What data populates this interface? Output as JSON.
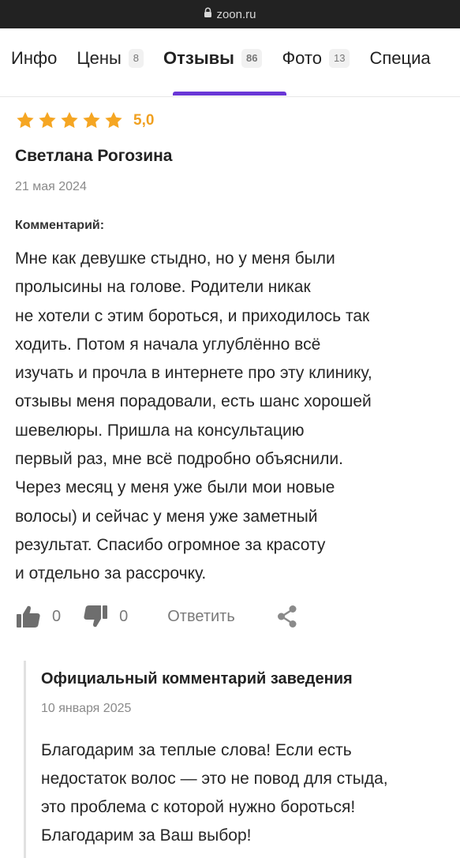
{
  "browser": {
    "url": "zoon.ru"
  },
  "tabs": [
    {
      "label": "Инфо",
      "count": ""
    },
    {
      "label": "Цены",
      "count": "8"
    },
    {
      "label": "Отзывы",
      "count": "86"
    },
    {
      "label": "Фото",
      "count": "13"
    },
    {
      "label": "Специа",
      "count": ""
    }
  ],
  "review": {
    "rating": "5,0",
    "stars": 5,
    "author": "Светлана Рогозина",
    "date": "21 мая 2024",
    "comment_label": "Комментарий:",
    "text_lines": [
      "Мне как девушке стыдно, но у меня были",
      "пролысины на голове. Родители никак",
      "не хотели с этим бороться, и приходилось так",
      "ходить. Потом я начала углублённо всё",
      "изучать и прочла в интернете про эту клинику,",
      "отзывы меня порадовали, есть шанс хорошей",
      "шевелюры. Пришла на консультацию",
      "первый раз, мне всё подробно объяснили.",
      "Через месяц у меня уже были мои новые",
      "волосы) и сейчас у меня уже заметный",
      "результат. Спасибо огромное за красоту",
      "и отдельно за рассрочку."
    ],
    "likes": "0",
    "dislikes": "0",
    "reply_label": "Ответить"
  },
  "official": {
    "title": "Официальный комментарий заведения",
    "date": "10 января 2025",
    "text_lines": [
      "Благодарим за теплые слова! Если есть",
      "недостаток волос — это не повод для стыда,",
      "это проблема с которой нужно бороться!",
      "Благодарим за Ваш выбор!"
    ]
  },
  "colors": {
    "accent": "#6a37d6",
    "star": "#f5a623",
    "rating_text": "#f0a020"
  }
}
